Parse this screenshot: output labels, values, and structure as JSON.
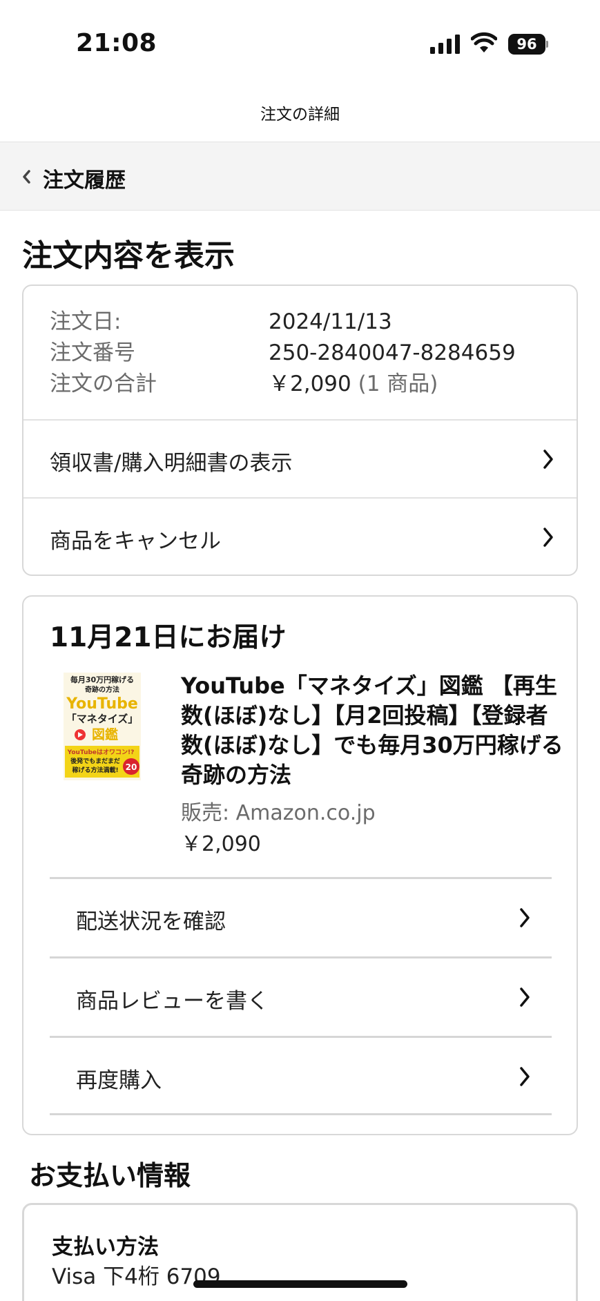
{
  "status_bar": {
    "time": "21:08",
    "battery": "96"
  },
  "nav": {
    "title": "注文の詳細",
    "back_label": "注文履歴"
  },
  "page": {
    "heading": "注文内容を表示"
  },
  "order_info": {
    "date_label": "注文日:",
    "date_value": "2024/11/13",
    "number_label": "注文番号",
    "number_value": "250-2840047-8284659",
    "total_label": "注文の合計",
    "total_value": "￥2,090",
    "total_items": "(1 商品)"
  },
  "order_links": {
    "receipt": "領収書/購入明細書の表示",
    "cancel": "商品をキャンセル"
  },
  "shipment": {
    "delivery_date": "11月21日にお届け",
    "product_title": "YouTube「マネタイズ」図鑑 【再生数(ほぼ)なし】【月2回投稿】【登録者数(ほぼ)なし】でも毎月30万円稼げる奇跡の方法",
    "seller": "販売: Amazon.co.jp",
    "price": "￥2,090",
    "cover": {
      "line1": "毎月30万円稼げる",
      "line2": "奇跡の方法",
      "brand": "YouTube",
      "tagline": "「マネタイズ」",
      "tag2": "図鑑",
      "banner": "YouTubeはオワコン!?",
      "banner2": "後発でもまだまだ",
      "banner3": "稼げる方法満載!",
      "badge": "20"
    },
    "actions": {
      "track": "配送状況を確認",
      "review": "商品レビューを書く",
      "buy_again": "再度購入"
    }
  },
  "payment": {
    "heading": "お支払い情報",
    "method_label": "支払い方法",
    "card_text": "Visa 下4桁 6709"
  }
}
